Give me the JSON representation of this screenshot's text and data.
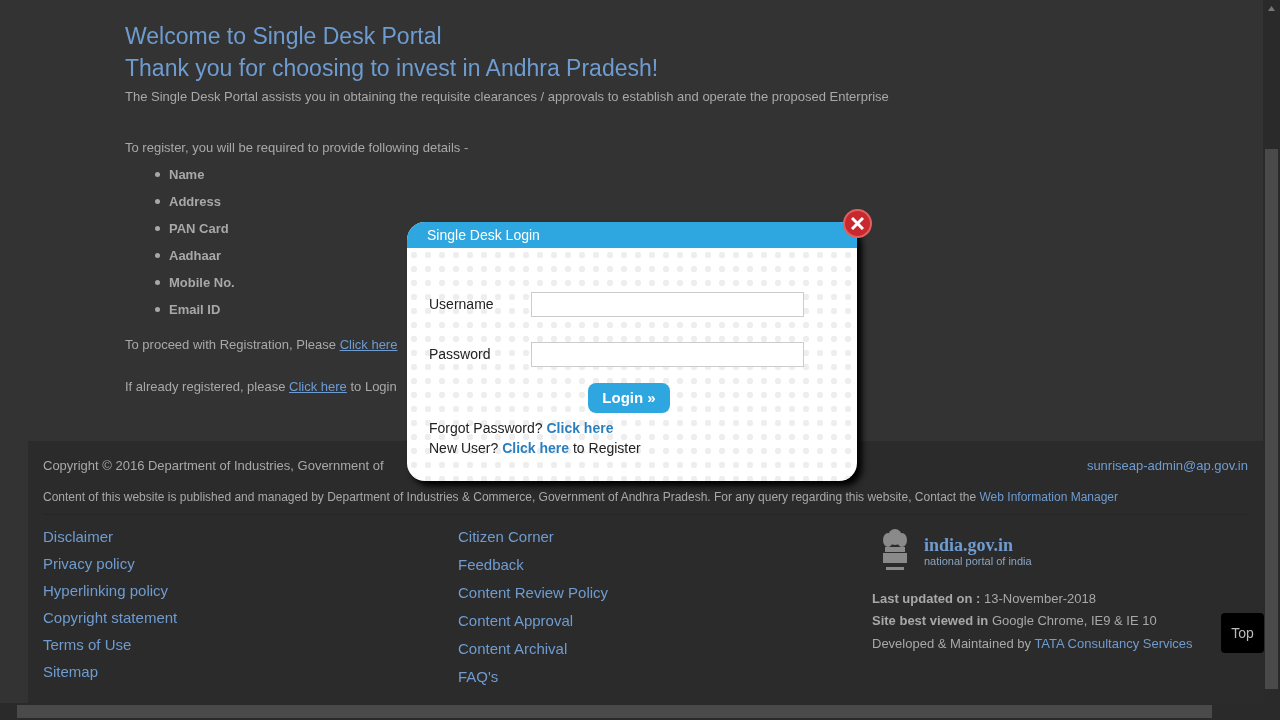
{
  "intro": {
    "title": "Welcome to Single Desk Portal",
    "subtitle": "Thank you for choosing to invest in Andhra Pradesh!",
    "description": "The Single Desk Portal assists you in obtaining the requisite clearances / approvals to establish and operate the proposed Enterprise",
    "register_intro": "To register, you will be required to provide following details -",
    "details": [
      "Name",
      "Address",
      "PAN Card",
      "Aadhaar",
      "Mobile No.",
      "Email ID"
    ],
    "proceed": {
      "before": "To proceed with Registration, Please ",
      "link": "Click here"
    },
    "login_line": {
      "before": "If already registered, please ",
      "link": "Click here",
      "after": " to Login"
    }
  },
  "login_dialog": {
    "title": "Single Desk Login",
    "fields": [
      {
        "label": "Username"
      },
      {
        "label": "Password"
      }
    ],
    "button": "Login »",
    "forgot": {
      "before": "Forgot Password? ",
      "link": "Click here"
    },
    "new_user": {
      "before": "New User? ",
      "link": "Click here",
      "after": " to Register"
    }
  },
  "footer": {
    "copyright": "Copyright © 2016 Department of Industries, Government of",
    "email": "sunriseap-admin@ap.gov.in",
    "content_note": {
      "before": "Content of this website is published and managed by Department of Industries & Commerce, Government of Andhra Pradesh. For any query regarding this website, Contact the ",
      "link": "Web Information Manager"
    },
    "links_col_1": [
      "Disclaimer",
      "Privacy policy",
      "Hyperlinking policy",
      "Copyright statement",
      "Terms of Use",
      "Sitemap"
    ],
    "links_col_2": [
      "Citizen Corner",
      "Feedback",
      "Content Review Policy",
      "Content Approval",
      "Content Archival",
      "FAQ's"
    ],
    "portal": {
      "name": "india.gov.in",
      "tagline": "national portal of india"
    },
    "info": [
      {
        "label": "Last updated on :",
        "value": " 13-November-2018"
      },
      {
        "label": "Site best viewed in",
        "value": " Google Chrome, IE9 & IE 10"
      },
      {
        "value": "Developed & Maintained by ",
        "link": "TATA Consultancy Services"
      }
    ]
  },
  "top_button": "Top"
}
